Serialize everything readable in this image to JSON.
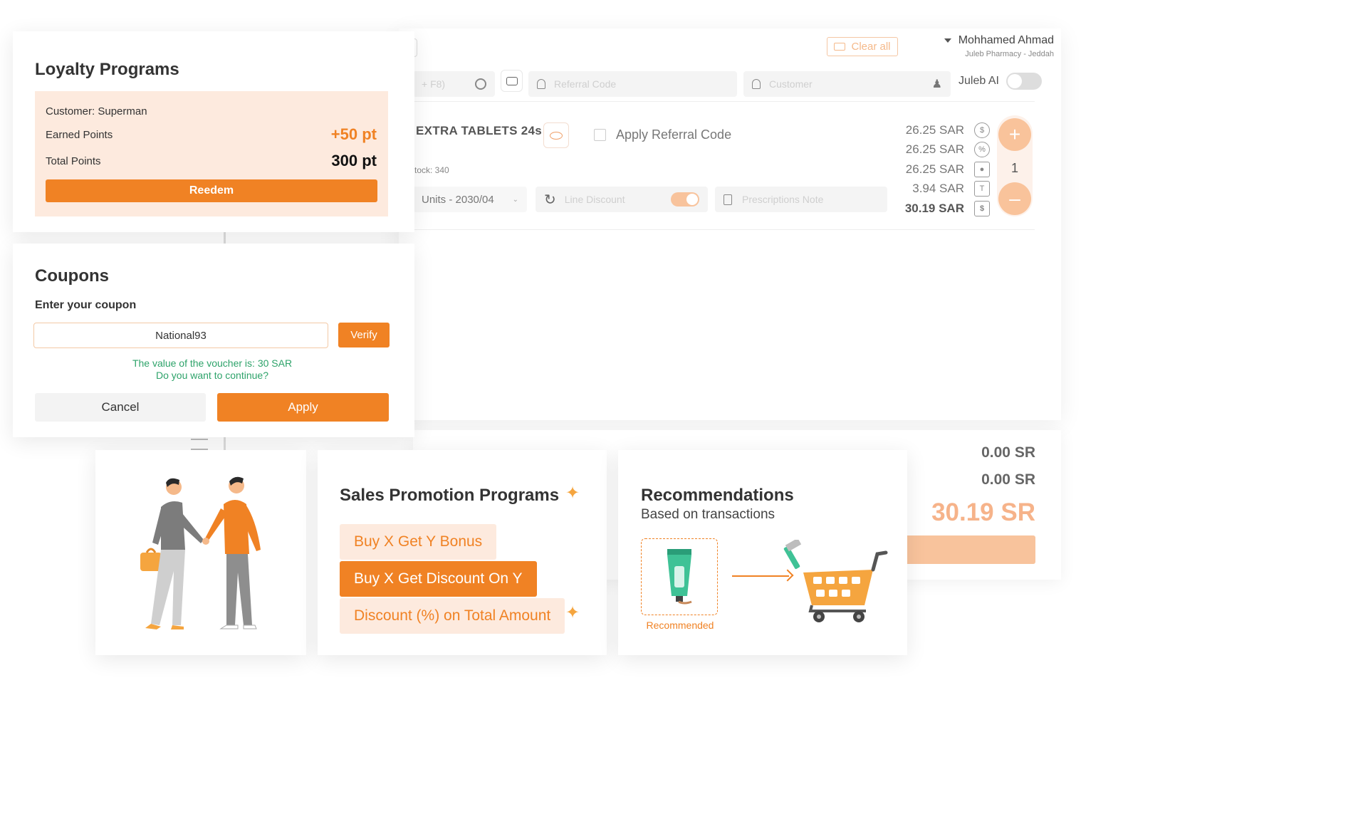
{
  "header": {
    "clear_all": "Clear all",
    "user_name": "Mohhamed Ahmad",
    "user_sub": "Juleb Pharmacy - Jeddah"
  },
  "search_bar": {
    "shortcut_hint": "+ F8)",
    "referral_placeholder": "Referral Code",
    "customer_placeholder": "Customer",
    "juleb_ai_label": "Juleb AI"
  },
  "product": {
    "name": "EXTRA TABLETS 24s",
    "stock": "tock: 340",
    "apply_referral": "Apply Referral Code",
    "units_select": "Units - 2030/04",
    "line_discount_placeholder": "Line Discount",
    "prescription_placeholder": "Prescriptions Note",
    "prices": [
      "26.25 SAR",
      "26.25 SAR",
      "26.25 SAR",
      "3.94 SAR",
      "30.19 SAR"
    ],
    "quantity": "1"
  },
  "totals": {
    "value1": "0.00 SR",
    "value2": "0.00 SR",
    "grand_total": "30.19 SR"
  },
  "loyalty": {
    "title": "Loyalty Programs",
    "customer": "Customer: Superman",
    "earned_label": "Earned Points",
    "earned_value": "+50 pt",
    "total_label": "Total Points",
    "total_value": "300 pt",
    "redeem": "Reedem"
  },
  "coupons": {
    "title": "Coupons",
    "enter_label": "Enter your coupon",
    "code_value": "National93",
    "verify": "Verify",
    "message_line1": "The value of the voucher is: 30 SAR",
    "message_line2": "Do you want to continue?",
    "cancel": "Cancel",
    "apply": "Apply"
  },
  "promotions": {
    "title": "Sales Promotion Programs",
    "items": [
      "Buy X Get Y Bonus",
      "Buy X Get Discount On Y",
      "Discount (%) on Total Amount"
    ]
  },
  "recommendations": {
    "title": "Recommendations",
    "subtitle": "Based on transactions",
    "recommended_label": "Recommended"
  },
  "colors": {
    "accent": "#f08224",
    "accent_light": "#fde9dc",
    "success_text": "#2ea36a"
  }
}
